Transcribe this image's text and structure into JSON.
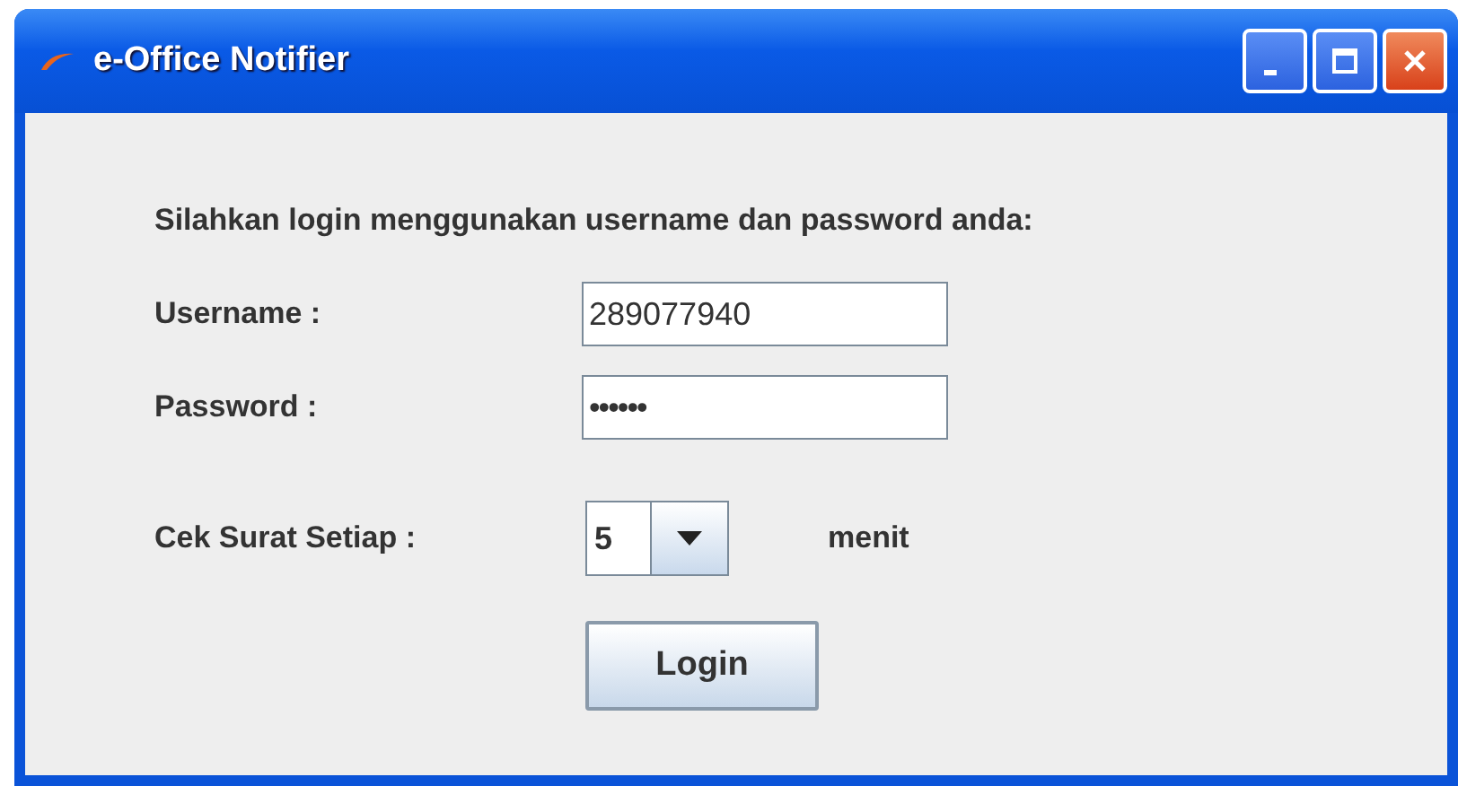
{
  "window": {
    "title": "e-Office Notifier"
  },
  "prompt": "Silahkan login menggunakan username dan password anda:",
  "fields": [
    {
      "label": "Username :",
      "value": "289077940"
    },
    {
      "label": "Password :",
      "value": "••••••"
    }
  ],
  "interval": {
    "label": "Cek Surat Setiap :",
    "value": "5",
    "unit": "menit"
  },
  "buttons": [
    "Login"
  ]
}
